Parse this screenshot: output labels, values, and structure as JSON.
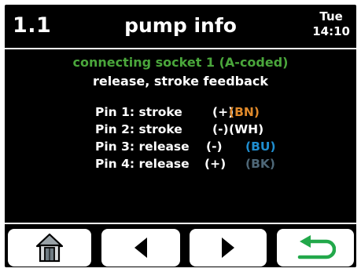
{
  "header": {
    "menu_number": "1.1",
    "title": "pump info",
    "day": "Tue",
    "time": "14:10"
  },
  "socket_line": "connecting socket 1 (A-coded)",
  "subtitle": "release, stroke feedback",
  "pins": [
    {
      "label": "Pin 1: stroke",
      "polarity": "(+)",
      "wire": "(BN)",
      "wire_color": "#e08a2b"
    },
    {
      "label": "Pin 2: stroke",
      "polarity": "(-)",
      "wire": "(WH)",
      "wire_color": "#ffffff"
    },
    {
      "label": "Pin 3: release",
      "polarity": "(-)",
      "wire": "(BU)",
      "wire_color": "#1f8ed0"
    },
    {
      "label": "Pin 4: release",
      "polarity": "(+)",
      "wire": "(BK)",
      "wire_color": "#4e6777"
    }
  ],
  "buttons": [
    {
      "icon": "home-icon"
    },
    {
      "icon": "arrow-left-icon"
    },
    {
      "icon": "arrow-right-icon"
    },
    {
      "icon": "return-icon"
    }
  ],
  "colors": {
    "background": "#000000",
    "text": "#ffffff",
    "socket_green": "#4aa63b",
    "return_green": "#22a84a"
  }
}
